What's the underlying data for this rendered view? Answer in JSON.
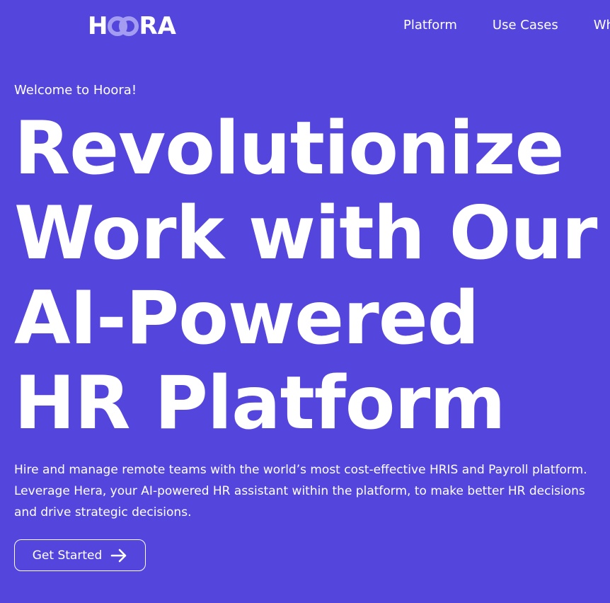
{
  "header": {
    "logo": {
      "prefix": "H",
      "suffix": "RA"
    },
    "nav": [
      {
        "label": "Platform"
      },
      {
        "label": "Use Cases"
      },
      {
        "label": "Wh"
      }
    ]
  },
  "hero": {
    "eyebrow": "Welcome to Hoora!",
    "headline_lines": [
      "Revolutionize",
      "Work with Our",
      "AI-Powered",
      "HR Platform"
    ],
    "description_lines": [
      "Hire and manage remote teams with the world’s most cost-effective HRIS and Payroll platform.",
      "Leverage Hera, your AI-powered HR assistant within the platform, to make better HR decisions",
      "and drive strategic decisions."
    ],
    "cta_label": "Get Started",
    "cta_icon": "arrow-right-icon"
  },
  "colors": {
    "background": "#5446dc",
    "text": "#ffffff",
    "logo_rings": "#a39cf0"
  }
}
